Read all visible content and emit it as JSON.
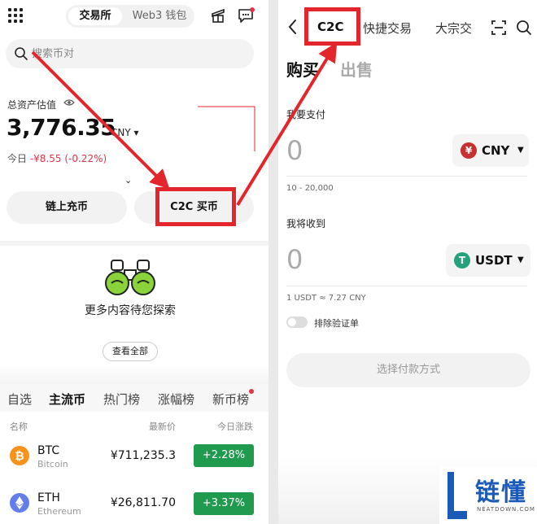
{
  "left": {
    "segment": {
      "exchange": "交易所",
      "web3": "Web3 钱包"
    },
    "search_placeholder": "搜索币对",
    "assets": {
      "label": "总资产估值",
      "value": "3,776.35",
      "unit": "CNY ▾",
      "today_prefix": "今日",
      "today_change": "-¥8.55 (-0.22%)"
    },
    "buttons": {
      "deposit": "链上充币",
      "c2c": "C2C 买币"
    },
    "explore": {
      "text": "更多内容待您探索",
      "view_all": "查看全部"
    },
    "tabs": [
      "自选",
      "主流币",
      "热门榜",
      "涨幅榜",
      "新币榜"
    ],
    "list_headers": {
      "name": "名称",
      "price": "最新价",
      "change": "今日涨跌"
    },
    "coins": [
      {
        "symbol": "BTC",
        "name": "Bitcoin",
        "price": "¥711,235.3",
        "change": "+2.28%"
      },
      {
        "symbol": "ETH",
        "name": "Ethereum",
        "price": "¥26,811.70",
        "change": "+3.37%"
      }
    ]
  },
  "right": {
    "tabs": {
      "c2c": "C2C",
      "quick": "快捷交易",
      "bulk": "大宗交"
    },
    "buy": "购买",
    "sell": "出售",
    "pay": {
      "label": "我要支付",
      "amount": "0",
      "currency": "CNY",
      "range": "10 - 20,000"
    },
    "receive": {
      "label": "我将收到",
      "amount": "0",
      "currency": "USDT",
      "rate": "1 USDT ≈ 7.27 CNY"
    },
    "toggle_label": "排除验证单",
    "pay_method_button": "选择付款方式"
  },
  "colors": {
    "highlight_red": "#e3262b",
    "positive_green": "#1f9a4f",
    "negative_red": "#e0344a",
    "usdt_green": "#26a17b",
    "cny_red": "#c8302f",
    "watermark_blue": "#1a5bb8"
  },
  "watermark": {
    "text": "链懂",
    "sub": "NEATDOWN.COM"
  }
}
